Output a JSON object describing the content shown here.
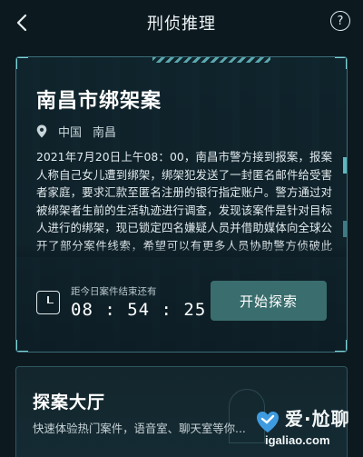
{
  "header": {
    "title": "刑侦推理",
    "help_label": "?"
  },
  "case": {
    "title": "南昌市绑架案",
    "location": {
      "country": "中国",
      "city": "南昌"
    },
    "description": "2021年7月20日上午08：00，南昌市警方接到报案，报案人称自己女儿遭到绑架，绑架犯发送了一封匿名邮件给受害者家庭，要求汇款至匿名注册的银行指定账户。警方通过对被绑架者生前的生活轨迹进行调查，发现该案件是针对目标人进行的绑架，现已锁定四名嫌疑人员并借助媒体向全球公开了部分案件线索，希望可以有更多人员协助警方侦破此案。",
    "timer_label": "距今日案件结束还有",
    "timer_value": "08 : 54 : 25",
    "start_label": "开始探索"
  },
  "hall": {
    "title": "探案大厅",
    "subtitle": "快速体验热门案件，语音室、聊天室等你..."
  },
  "watermark": {
    "brand": "爱·尬聊",
    "url": "igaliao.com"
  },
  "colors": {
    "background": "#0c1a20",
    "accent": "#7fd4d8",
    "button": "#3a6e6e"
  }
}
